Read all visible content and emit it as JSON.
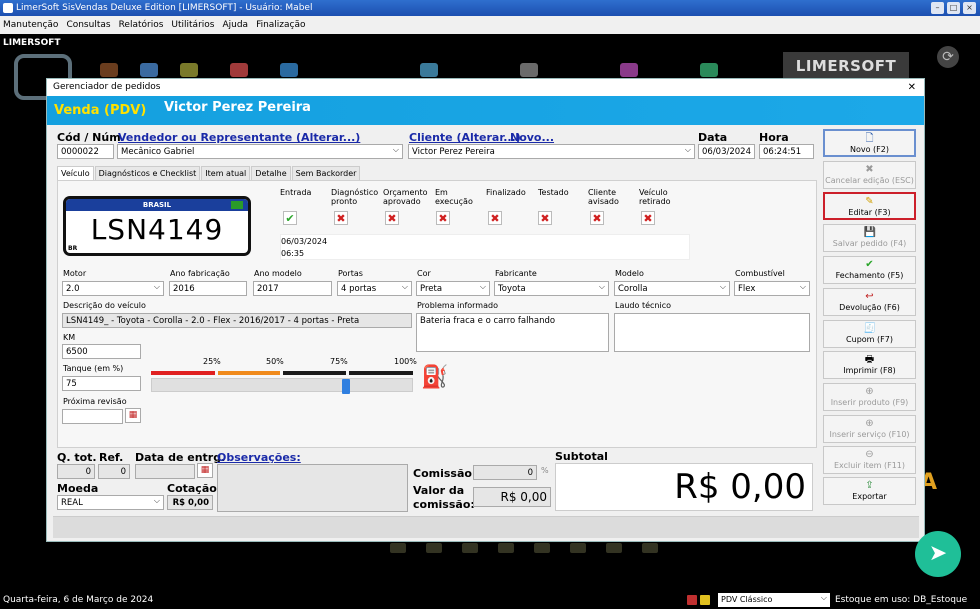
{
  "window": {
    "title": "LimerSoft SisVendas Deluxe Edition [LIMERSOFT] - Usuário: Mabel"
  },
  "menu": [
    "Manutenção",
    "Consultas",
    "Relatórios",
    "Utilitários",
    "Ajuda",
    "Finalização"
  ],
  "background": {
    "brand": "LIMERSOFT",
    "logo": "LIMERSOFT"
  },
  "dialog": {
    "title": "Gerenciador de pedidos",
    "mode": "Venda (PDV)",
    "client_banner": "Victor Perez Pereira",
    "header": {
      "cod_num_label": "Cód / Núm",
      "cod_num_value": "0000022",
      "vendedor_link": "Vendedor ou Representante (Alterar...)",
      "vendedor_value": "Mecânico Gabriel",
      "cliente_link": "Cliente (Alterar...)",
      "novo_link": "Novo...",
      "cliente_value": "Victor Perez Pereira",
      "data_label": "Data",
      "data_value": "06/03/2024",
      "hora_label": "Hora",
      "hora_value": "06:24:51"
    },
    "tabs": [
      "Veículo",
      "Diagnósticos e Checklist",
      "Item atual",
      "Detalhe",
      "Sem Backorder"
    ],
    "plate": {
      "country": "BRASIL",
      "number": "LSN4149",
      "code": "BR"
    },
    "steps": [
      {
        "label": "Entrada",
        "status": "done"
      },
      {
        "label": "Diagnóstico pronto",
        "status": "pending"
      },
      {
        "label": "Orçamento aprovado",
        "status": "pending"
      },
      {
        "label": "Em execução",
        "status": "pending"
      },
      {
        "label": "Finalizado",
        "status": "pending"
      },
      {
        "label": "Testado",
        "status": "pending"
      },
      {
        "label": "Cliente avisado",
        "status": "pending"
      },
      {
        "label": "Veículo retirado",
        "status": "pending"
      }
    ],
    "entrada_info": {
      "date": "06/03/2024",
      "time": "06:35"
    },
    "vehicle": {
      "motor_label": "Motor",
      "motor_value": "2.0",
      "ano_fab_label": "Ano fabricação",
      "ano_fab_value": "2016",
      "ano_mod_label": "Ano modelo",
      "ano_mod_value": "2017",
      "portas_label": "Portas",
      "portas_value": "4 portas",
      "cor_label": "Cor",
      "cor_value": "Preta",
      "fabricante_label": "Fabricante",
      "fabricante_value": "Toyota",
      "modelo_label": "Modelo",
      "modelo_value": "Corolla",
      "combustivel_label": "Combustível",
      "combustivel_value": "Flex",
      "descricao_label": "Descrição do veículo",
      "descricao_value": "LSN4149_ - Toyota - Corolla - 2.0 - Flex - 2016/2017 - 4 portas - Preta",
      "problema_label": "Problema informado",
      "problema_value": "Bateria fraca e o carro falhando",
      "laudo_label": "Laudo técnico",
      "laudo_value": "",
      "km_label": "KM",
      "km_value": "6500",
      "tanque_label": "Tanque (em %)",
      "tanque_value": "75",
      "revisao_label": "Próxima revisão",
      "revisao_value": ""
    },
    "tank_scale": [
      "25%",
      "50%",
      "75%",
      "100%"
    ],
    "tank_level": 0.75,
    "tank_colors": [
      "#e02020",
      "#f08a1c",
      "#1a1a1a",
      "#1a1a1a"
    ],
    "footer": {
      "qtot_label": "Q. tot.",
      "qtot_value": "0",
      "ref_label": "Ref.",
      "ref_value": "0",
      "data_entrega_label": "Data de entrg.",
      "data_entrega_value": "",
      "observacoes_link": "Observações:",
      "moeda_label": "Moeda",
      "moeda_value": "REAL",
      "cotacao_label": "Cotação",
      "cotacao_value": "R$ 0,00",
      "comissao_label": "Comissão:",
      "comissao_value": "0",
      "comissao_unit": "%",
      "valor_comissao_label_1": "Valor da",
      "valor_comissao_label_2": "comissão:",
      "valor_comissao_value": "R$ 0,00",
      "subtotal_label": "Subtotal",
      "subtotal_value": "R$ 0,00"
    },
    "side_buttons": [
      {
        "label": "Novo (F2)",
        "icon": "new-doc-icon",
        "enabled": true
      },
      {
        "label": "Cancelar edição (ESC)",
        "icon": "cancel-icon",
        "enabled": false
      },
      {
        "label": "Editar (F3)",
        "icon": "pencil-icon",
        "enabled": true,
        "highlighted": true
      },
      {
        "label": "Salvar pedido (F4)",
        "icon": "save-icon",
        "enabled": false
      },
      {
        "label": "Fechamento (F5)",
        "icon": "check-icon",
        "enabled": true
      },
      {
        "label": "Devolução (F6)",
        "icon": "return-icon",
        "enabled": true
      },
      {
        "label": "Cupom (F7)",
        "icon": "receipt-icon",
        "enabled": true
      },
      {
        "label": "Imprimir (F8)",
        "icon": "printer-icon",
        "enabled": true
      },
      {
        "label": "Inserir produto (F9)",
        "icon": "insert-product-icon",
        "enabled": false
      },
      {
        "label": "Inserir serviço (F10)",
        "icon": "insert-service-icon",
        "enabled": false
      },
      {
        "label": "Excluir item (F11)",
        "icon": "delete-item-icon",
        "enabled": false
      },
      {
        "label": "Exportar",
        "icon": "export-icon",
        "enabled": true
      }
    ]
  },
  "status": {
    "date": "Quarta-feira, 6 de Março de 2024",
    "pdv": "PDV Clássico",
    "estoque": "Estoque em uso: DB_Estoque"
  }
}
